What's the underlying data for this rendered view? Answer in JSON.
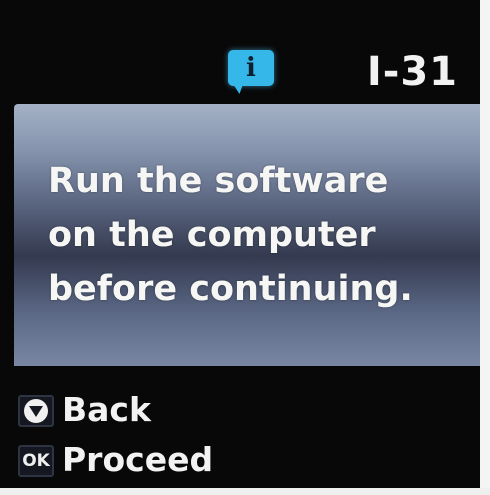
{
  "status_bar": {
    "icon": "info-speech-bubble-icon",
    "icon_glyph": "i",
    "icon_color": "#36b7ea",
    "code": "I-31"
  },
  "message": {
    "lines": [
      "Run the software",
      "on the computer",
      "before continuing."
    ],
    "text": "Run the software\non the computer\nbefore continuing."
  },
  "softkeys": [
    {
      "icon": "stop-button-icon",
      "glyph": "",
      "label": "Back"
    },
    {
      "icon": "ok-button-icon",
      "glyph": "OK",
      "label": "Proceed"
    }
  ]
}
